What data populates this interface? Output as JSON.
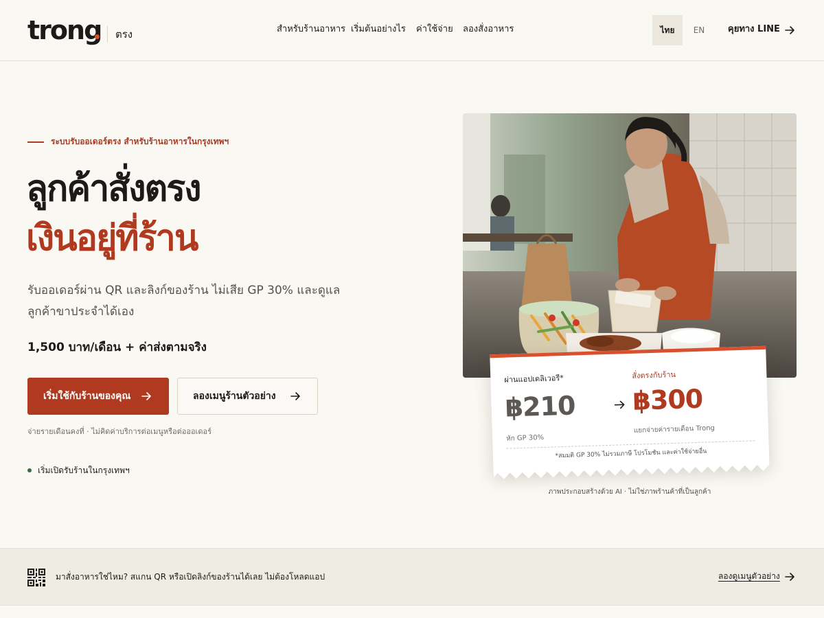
{
  "header": {
    "logo": "trong",
    "logo_thai": "ตรง",
    "nav": [
      {
        "label": "สำหรับร้านอาหาร"
      },
      {
        "label": "เริ่มต้นอย่างไร"
      },
      {
        "label": "ค่าใช้จ่าย"
      },
      {
        "label": "ลองสั่งอาหาร"
      }
    ],
    "lang_active": "ไทย",
    "lang_other": "EN",
    "contact_label": "คุยทาง LINE",
    "contact_icon": "arrow-right-icon"
  },
  "hero": {
    "eyebrow": "ระบบรับออเดอร์ตรง สำหรับร้านอาหารในกรุงเทพฯ",
    "headline_1": "ลูกค้าสั่งตรง",
    "headline_2": "เงินอยู่ที่ร้าน",
    "subheadline": "รับออเดอร์ผ่าน QR และลิงก์ของร้าน ไม่เสีย GP 30% และดูแลลูกค้าขาประจำได้เอง",
    "price": "1,500 บาท/เดือน + ค่าส่งตามจริง",
    "cta_primary": "เริ่มใช้กับร้านของคุณ",
    "cta_secondary": "ลองเมนูร้านตัวอย่าง",
    "fine_print": "จ่ายรายเดือนคงที่ · ไม่คิดค่าบริการต่อเมนูหรือต่อออเดอร์",
    "status": "เริ่มเปิดรับร้านในกรุงเทพฯ"
  },
  "receipt": {
    "app_label": "ผ่านแอปเดลิเวอรี*",
    "app_amount": "฿210",
    "app_sub": "หัก GP 30%",
    "direct_label": "สั่งตรงกับร้าน",
    "direct_amount": "฿300",
    "direct_sub": "แยกจ่ายค่ารายเดือน Trong",
    "footnote": "*สมมติ GP 30% ไม่รวมภาษี โปรโมชัน และค่าใช้จ่ายอื่น"
  },
  "image_caption": "ภาพประกอบสร้างด้วย AI · ไม่ใช่ภาพร้านค้าที่เป็นลูกค้า",
  "bottom_bar": {
    "icon": "qr-code-icon",
    "text": "มาสั่งอาหารใช่ไหม? สแกน QR หรือเปิดลิงก์ของร้านได้เลย ไม่ต้องโหลดแอป",
    "link": "ลองดูเมนูตัวอย่าง"
  },
  "colors": {
    "accent": "#b03a1f",
    "accent_bright": "#d9502e",
    "background": "#f9f8f3",
    "bar": "#efece4",
    "status": "#3b6b45"
  }
}
